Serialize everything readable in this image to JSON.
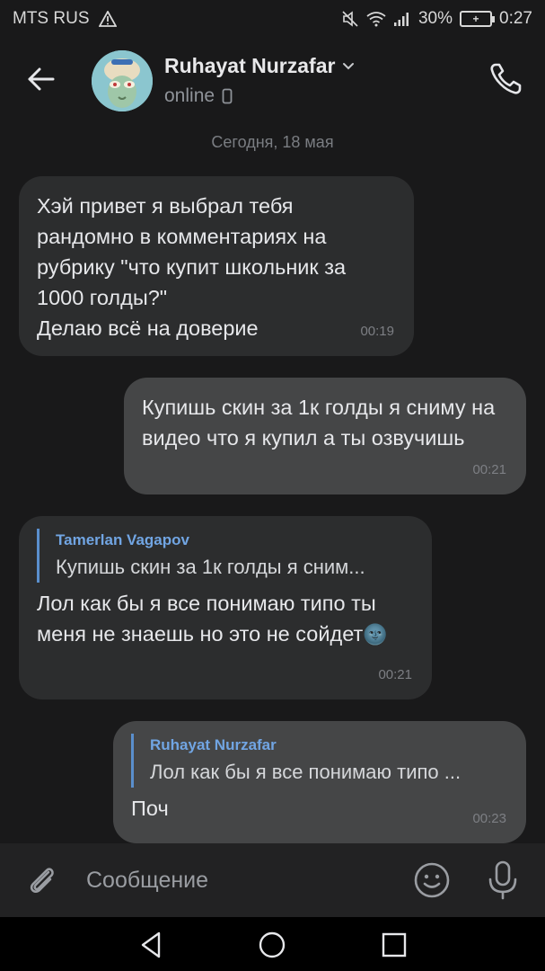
{
  "status_bar": {
    "carrier": "MTS RUS",
    "battery_percent": "30%",
    "time": "0:27",
    "icons": [
      "warning-icon",
      "mute-icon",
      "wifi-icon",
      "signal-icon",
      "battery-icon"
    ]
  },
  "header": {
    "name": "Ruhayat Nurzafar",
    "status": "online"
  },
  "date_separator": "Сегодня, 18 мая",
  "messages": [
    {
      "direction": "in",
      "text": "Хэй привет я выбрал тебя рандомно в комментариях на рубрику \"что купит школьник за 1000 голды?\"\nДелаю всё на доверие",
      "time": "00:19"
    },
    {
      "direction": "out",
      "text": "Купишь скин за 1к голды я сниму на видео что я купил а ты озвучишь",
      "time": "00:21"
    },
    {
      "direction": "in",
      "reply_author": "Tamerlan Vagapov",
      "reply_text": "Купишь скин за 1к голды я сним...",
      "text": "Лол как бы я все понимаю типо ты меня не знаешь но это не сойдет",
      "emoji": "🌚",
      "time": "00:21"
    },
    {
      "direction": "out",
      "reply_author": "Ruhayat Nurzafar",
      "reply_text": "Лол как бы я все понимаю типо ...",
      "text": "Поч",
      "time": "00:23"
    }
  ],
  "composer": {
    "placeholder": "Сообщение"
  },
  "colors": {
    "background": "#19191a",
    "incoming_bubble": "#2c2d2e",
    "outgoing_bubble": "#454647",
    "accent": "#71a5e3"
  }
}
